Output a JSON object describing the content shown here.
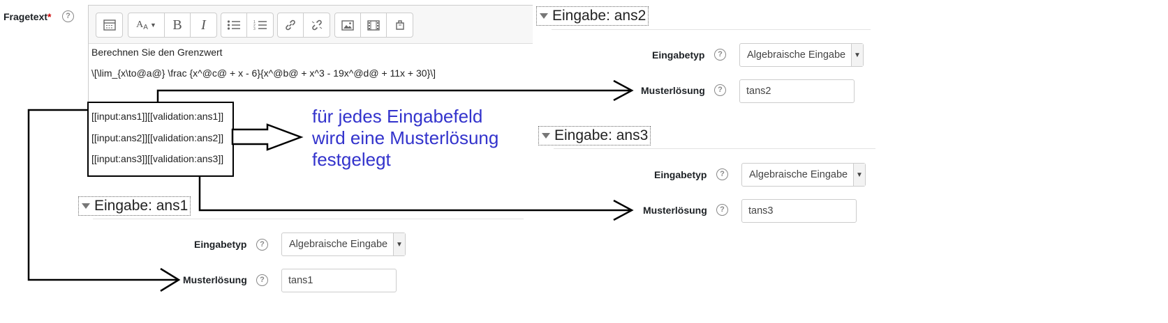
{
  "question": {
    "label": "Fragetext",
    "required_mark": "*",
    "help_icon": "question-circle-icon",
    "editor": {
      "toolbar": [
        "toolbar-toggle-icon",
        "font-style-icon",
        "bold-icon",
        "italic-icon",
        "unordered-list-icon",
        "ordered-list-icon",
        "link-icon",
        "unlink-icon",
        "image-icon",
        "media-icon",
        "manage-files-icon"
      ],
      "line1": "Berechnen Sie den Grenzwert",
      "line2": "\\[\\lim_{x\\to@a@} \\frac {x^@c@ + x - 6}{x^@b@ + x^3 - 19x^@d@ + 11x + 30}\\]",
      "inputs": [
        "[[input:ans1]][[validation:ans1]]",
        "[[input:ans2]][[validation:ans2]]",
        "[[input:ans3]][[validation:ans3]]"
      ]
    }
  },
  "annotation": {
    "line1": "für jedes Eingabefeld",
    "line2": "wird eine Musterlösung",
    "line3": "festgelegt",
    "color": "#3333cc"
  },
  "sections": [
    {
      "title": "Eingabe: ans1",
      "type_label": "Eingabetyp",
      "type_value": "Algebraische Eingabe",
      "answer_label": "Musterlösung",
      "answer_value": "tans1"
    },
    {
      "title": "Eingabe: ans2",
      "type_label": "Eingabetyp",
      "type_value": "Algebraische Eingabe",
      "answer_label": "Musterlösung",
      "answer_value": "tans2"
    },
    {
      "title": "Eingabe: ans3",
      "type_label": "Eingabetyp",
      "type_value": "Algebraische Eingabe",
      "answer_label": "Musterlösung",
      "answer_value": "tans3"
    }
  ]
}
